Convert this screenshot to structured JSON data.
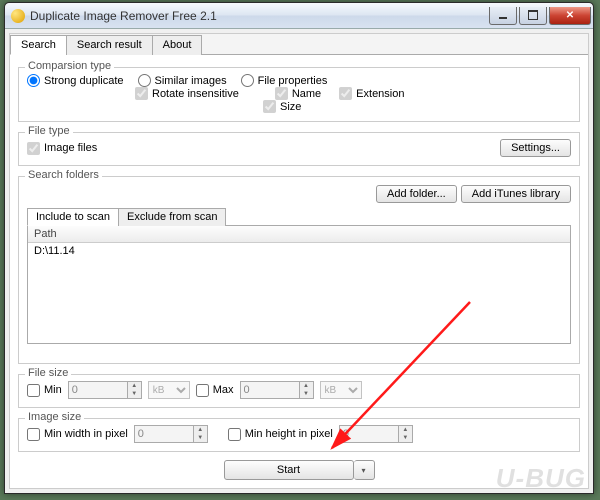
{
  "window": {
    "title": "Duplicate Image Remover Free 2.1"
  },
  "tabs": {
    "search": "Search",
    "result": "Search result",
    "about": "About"
  },
  "comparison": {
    "legend": "Comparsion type",
    "strong": "Strong duplicate",
    "similar": "Similar images",
    "fileprops": "File properties",
    "rotate": "Rotate insensitive",
    "name": "Name",
    "extension": "Extension",
    "size": "Size"
  },
  "filetype": {
    "legend": "File type",
    "imagefiles": "Image files",
    "settings": "Settings..."
  },
  "folders": {
    "legend": "Search folders",
    "add": "Add folder...",
    "itunes": "Add iTunes library",
    "include_tab": "Include to scan",
    "exclude_tab": "Exclude from scan",
    "path_header": "Path",
    "paths": [
      "D:\\11.14"
    ]
  },
  "filesize": {
    "legend": "File size",
    "min": "Min",
    "max": "Max",
    "min_val": "0",
    "max_val": "0",
    "unit": "kB"
  },
  "imagesize": {
    "legend": "Image size",
    "minw": "Min width in pixel",
    "minh": "Min height in pixel",
    "minw_val": "0",
    "minh_val": "0"
  },
  "start": "Start",
  "watermark": "U-BUG"
}
